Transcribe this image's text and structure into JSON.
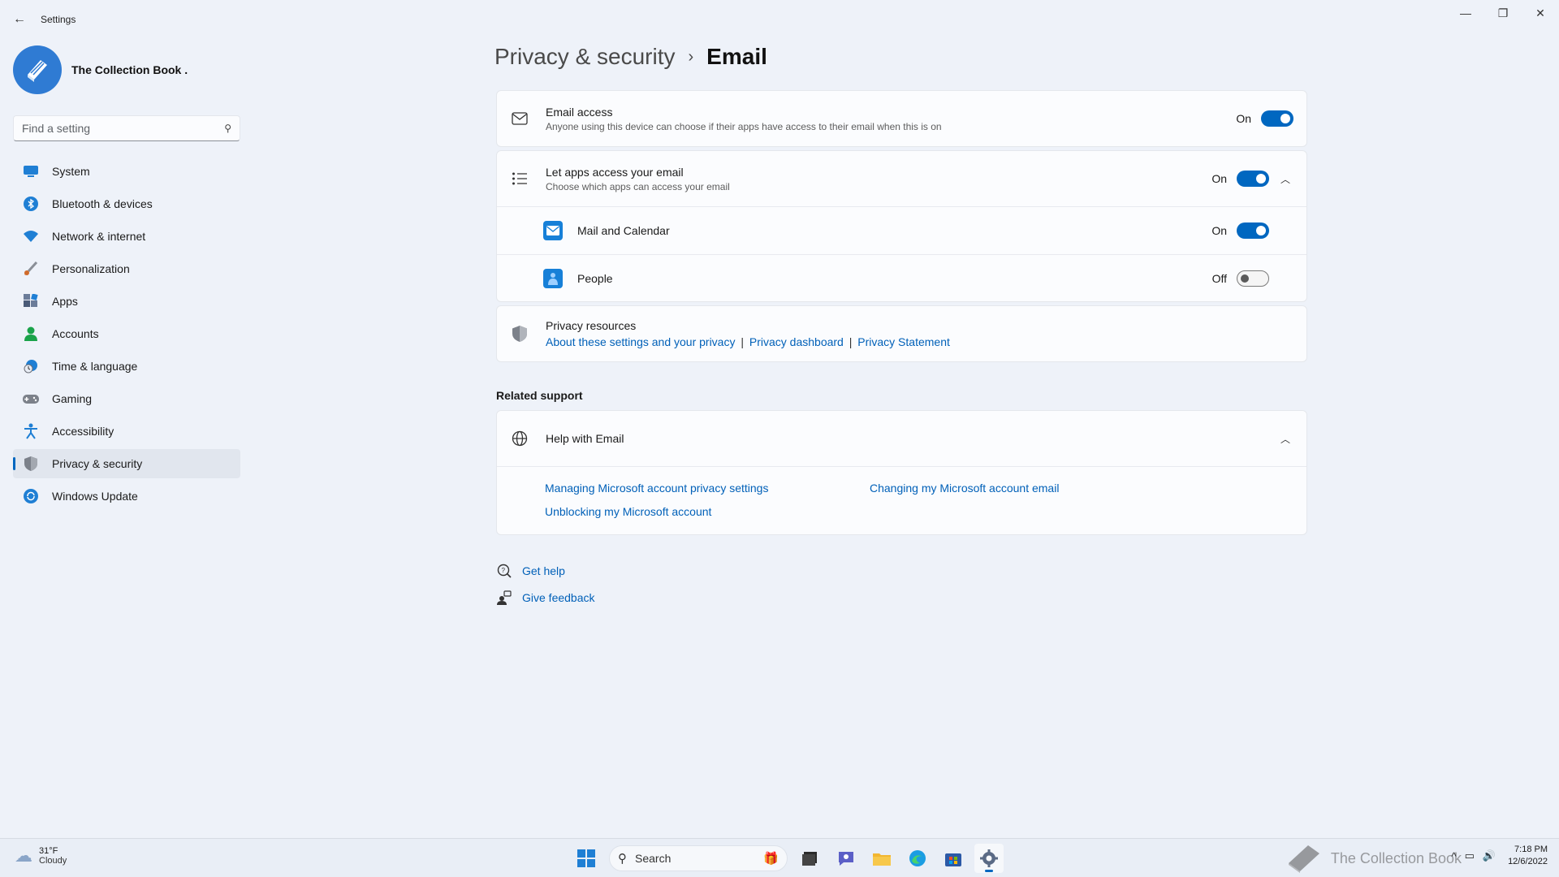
{
  "window": {
    "title": "Settings",
    "minimize": "—",
    "maximize": "❐",
    "close": "✕"
  },
  "profile": {
    "name": "The Collection Book ."
  },
  "search": {
    "placeholder": "Find a setting"
  },
  "nav": {
    "items": [
      {
        "label": "System",
        "icon": "system-icon",
        "color": "#1f7fd4",
        "selected": false
      },
      {
        "label": "Bluetooth & devices",
        "icon": "bluetooth-icon",
        "color": "#1f7fd4",
        "selected": false
      },
      {
        "label": "Network & internet",
        "icon": "wifi-icon",
        "color": "#1f7fd4",
        "selected": false
      },
      {
        "label": "Personalization",
        "icon": "brush-icon",
        "color": "#d06b2b",
        "selected": false
      },
      {
        "label": "Apps",
        "icon": "apps-icon",
        "color": "#4a5b78",
        "selected": false
      },
      {
        "label": "Accounts",
        "icon": "person-icon",
        "color": "#1aa34a",
        "selected": false
      },
      {
        "label": "Time & language",
        "icon": "globe-clock-icon",
        "color": "#1f7fd4",
        "selected": false
      },
      {
        "label": "Gaming",
        "icon": "gamepad-icon",
        "color": "#6b6f78",
        "selected": false
      },
      {
        "label": "Accessibility",
        "icon": "accessibility-icon",
        "color": "#1f7fd4",
        "selected": false
      },
      {
        "label": "Privacy & security",
        "icon": "shield-icon",
        "color": "#6b6f78",
        "selected": true
      },
      {
        "label": "Windows Update",
        "icon": "update-icon",
        "color": "#1f7fd4",
        "selected": false
      }
    ]
  },
  "breadcrumb": {
    "parent": "Privacy & security",
    "separator": "›",
    "current": "Email"
  },
  "email_access": {
    "title": "Email access",
    "subtitle": "Anyone using this device can choose if their apps have access to their email when this is on",
    "state": "On"
  },
  "apps_access": {
    "title": "Let apps access your email",
    "subtitle": "Choose which apps can access your email",
    "state": "On",
    "apps": [
      {
        "name": "Mail and Calendar",
        "state": "On"
      },
      {
        "name": "People",
        "state": "Off"
      }
    ]
  },
  "privacy_resources": {
    "title": "Privacy resources",
    "links": [
      "About these settings and your privacy",
      "Privacy dashboard",
      "Privacy Statement"
    ],
    "separator": "|"
  },
  "related_support": {
    "title": "Related support",
    "help_title": "Help with Email",
    "links": [
      "Managing Microsoft account privacy settings",
      "Changing my Microsoft account email",
      "Unblocking my Microsoft account"
    ]
  },
  "help": {
    "get_help": "Get help",
    "give_feedback": "Give feedback"
  },
  "taskbar": {
    "weather_temp": "31°F",
    "weather_cond": "Cloudy",
    "search_label": "Search",
    "time": "7:18 PM",
    "date": "12/6/2022",
    "watermark": "The Collection Book"
  },
  "colors": {
    "accent": "#0067c0",
    "link": "#0060b8",
    "background": "#eef2f9"
  }
}
